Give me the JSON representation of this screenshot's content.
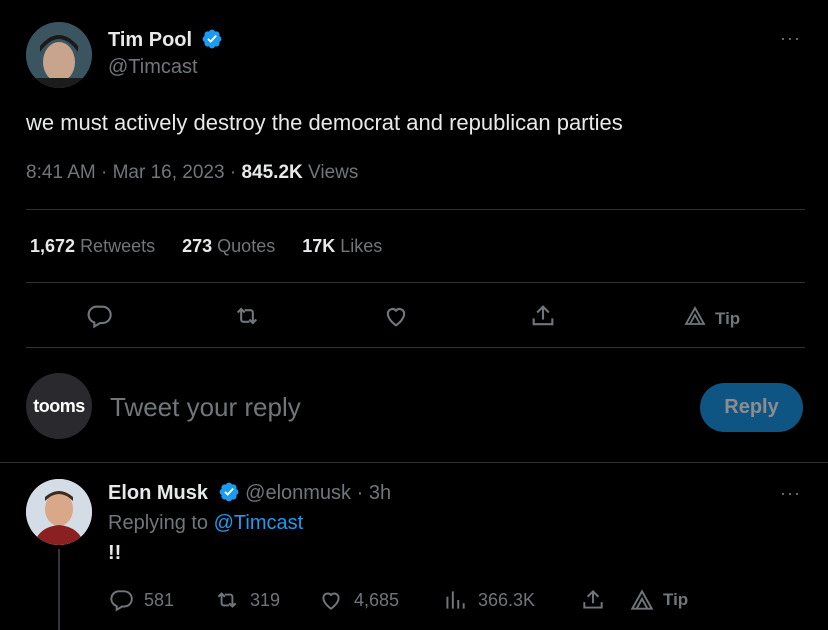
{
  "tweet": {
    "author_name": "Tim Pool",
    "author_handle": "@Timcast",
    "text": "we must actively destroy the democrat and republican parties",
    "time": "8:41 AM",
    "sep1": "·",
    "date": "Mar 16, 2023",
    "sep2": "·",
    "views_count": "845.2K",
    "views_label": "Views",
    "more": "···"
  },
  "stats": {
    "retweets_count": "1,672",
    "retweets_label": "Retweets",
    "quotes_count": "273",
    "quotes_label": "Quotes",
    "likes_count": "17K",
    "likes_label": "Likes"
  },
  "actions": {
    "tip_label": "Tip",
    "icons": [
      "reply-icon",
      "retweet-icon",
      "like-icon",
      "share-icon",
      "tip-icon"
    ]
  },
  "composer": {
    "avatar_text": "tooms",
    "placeholder": "Tweet your reply",
    "reply_button": "Reply"
  },
  "reply": {
    "author_name": "Elon Musk",
    "author_handle": "@elonmusk",
    "sep": "·",
    "age": "3h",
    "replying_prefix": "Replying to",
    "replying_to": "@Timcast",
    "text": "!!",
    "more": "···",
    "reply_count": "581",
    "retweet_count": "319",
    "like_count": "4,685",
    "view_count": "366.3K",
    "tip_label": "Tip"
  },
  "colors": {
    "background": "#000000",
    "text": "#e7e9ea",
    "muted": "#71767b",
    "accent": "#1d9bf0",
    "divider": "#2f3336"
  }
}
